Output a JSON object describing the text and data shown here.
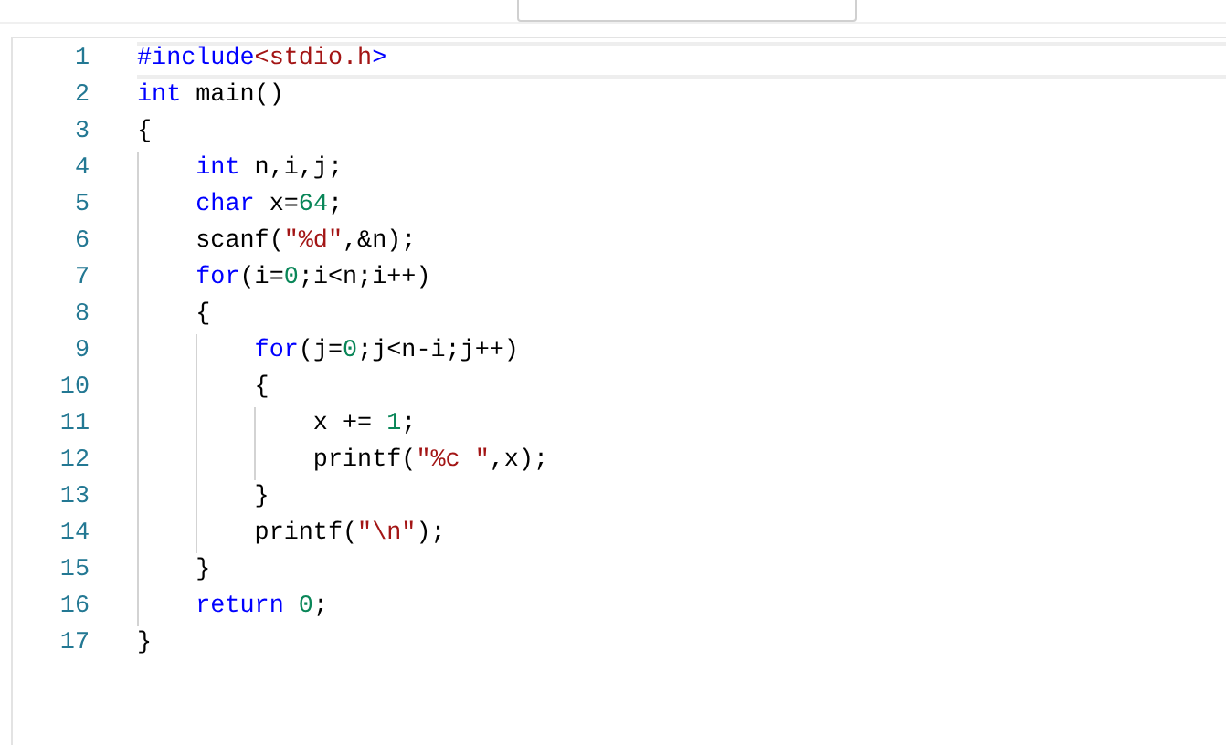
{
  "editor": {
    "lines": [
      {
        "number": "1",
        "selected": true,
        "tokens": [
          {
            "kind": "keyword",
            "text": "#include"
          },
          {
            "kind": "string",
            "text": "<stdio.h"
          },
          {
            "kind": "keyword",
            "text": ">"
          }
        ]
      },
      {
        "number": "2",
        "selected": false,
        "tokens": [
          {
            "kind": "keyword",
            "text": "int"
          },
          {
            "kind": "plain",
            "text": " main()"
          }
        ]
      },
      {
        "number": "3",
        "selected": false,
        "tokens": [
          {
            "kind": "plain",
            "text": "{"
          }
        ]
      },
      {
        "number": "4",
        "selected": false,
        "tokens": [
          {
            "kind": "keyword",
            "text": "    int"
          },
          {
            "kind": "plain",
            "text": " n,i,j;"
          }
        ]
      },
      {
        "number": "5",
        "selected": false,
        "tokens": [
          {
            "kind": "keyword",
            "text": "    char"
          },
          {
            "kind": "plain",
            "text": " x="
          },
          {
            "kind": "number",
            "text": "64"
          },
          {
            "kind": "plain",
            "text": ";"
          }
        ]
      },
      {
        "number": "6",
        "selected": false,
        "tokens": [
          {
            "kind": "plain",
            "text": "    scanf("
          },
          {
            "kind": "string",
            "text": "\"%d\""
          },
          {
            "kind": "plain",
            "text": ",&n);"
          }
        ]
      },
      {
        "number": "7",
        "selected": false,
        "tokens": [
          {
            "kind": "keyword",
            "text": "    for"
          },
          {
            "kind": "plain",
            "text": "(i="
          },
          {
            "kind": "number",
            "text": "0"
          },
          {
            "kind": "plain",
            "text": ";i<n;i++)"
          }
        ]
      },
      {
        "number": "8",
        "selected": false,
        "tokens": [
          {
            "kind": "plain",
            "text": "    {"
          }
        ]
      },
      {
        "number": "9",
        "selected": false,
        "tokens": [
          {
            "kind": "keyword",
            "text": "        for"
          },
          {
            "kind": "plain",
            "text": "(j="
          },
          {
            "kind": "number",
            "text": "0"
          },
          {
            "kind": "plain",
            "text": ";j<n-i;j++)"
          }
        ]
      },
      {
        "number": "10",
        "selected": false,
        "tokens": [
          {
            "kind": "plain",
            "text": "        {"
          }
        ]
      },
      {
        "number": "11",
        "selected": false,
        "tokens": [
          {
            "kind": "plain",
            "text": "            x += "
          },
          {
            "kind": "number",
            "text": "1"
          },
          {
            "kind": "plain",
            "text": ";"
          }
        ]
      },
      {
        "number": "12",
        "selected": false,
        "tokens": [
          {
            "kind": "plain",
            "text": "            printf("
          },
          {
            "kind": "string",
            "text": "\"%c \""
          },
          {
            "kind": "plain",
            "text": ",x);"
          }
        ]
      },
      {
        "number": "13",
        "selected": false,
        "tokens": [
          {
            "kind": "plain",
            "text": "        }"
          }
        ]
      },
      {
        "number": "14",
        "selected": false,
        "tokens": [
          {
            "kind": "plain",
            "text": "        printf("
          },
          {
            "kind": "string",
            "text": "\"\\n\""
          },
          {
            "kind": "plain",
            "text": ");"
          }
        ]
      },
      {
        "number": "15",
        "selected": false,
        "tokens": [
          {
            "kind": "plain",
            "text": "    }"
          }
        ]
      },
      {
        "number": "16",
        "selected": false,
        "tokens": [
          {
            "kind": "keyword",
            "text": "    return "
          },
          {
            "kind": "number",
            "text": "0"
          },
          {
            "kind": "plain",
            "text": ";"
          }
        ]
      },
      {
        "number": "17",
        "selected": false,
        "tokens": [
          {
            "kind": "plain",
            "text": "}"
          }
        ]
      }
    ]
  }
}
